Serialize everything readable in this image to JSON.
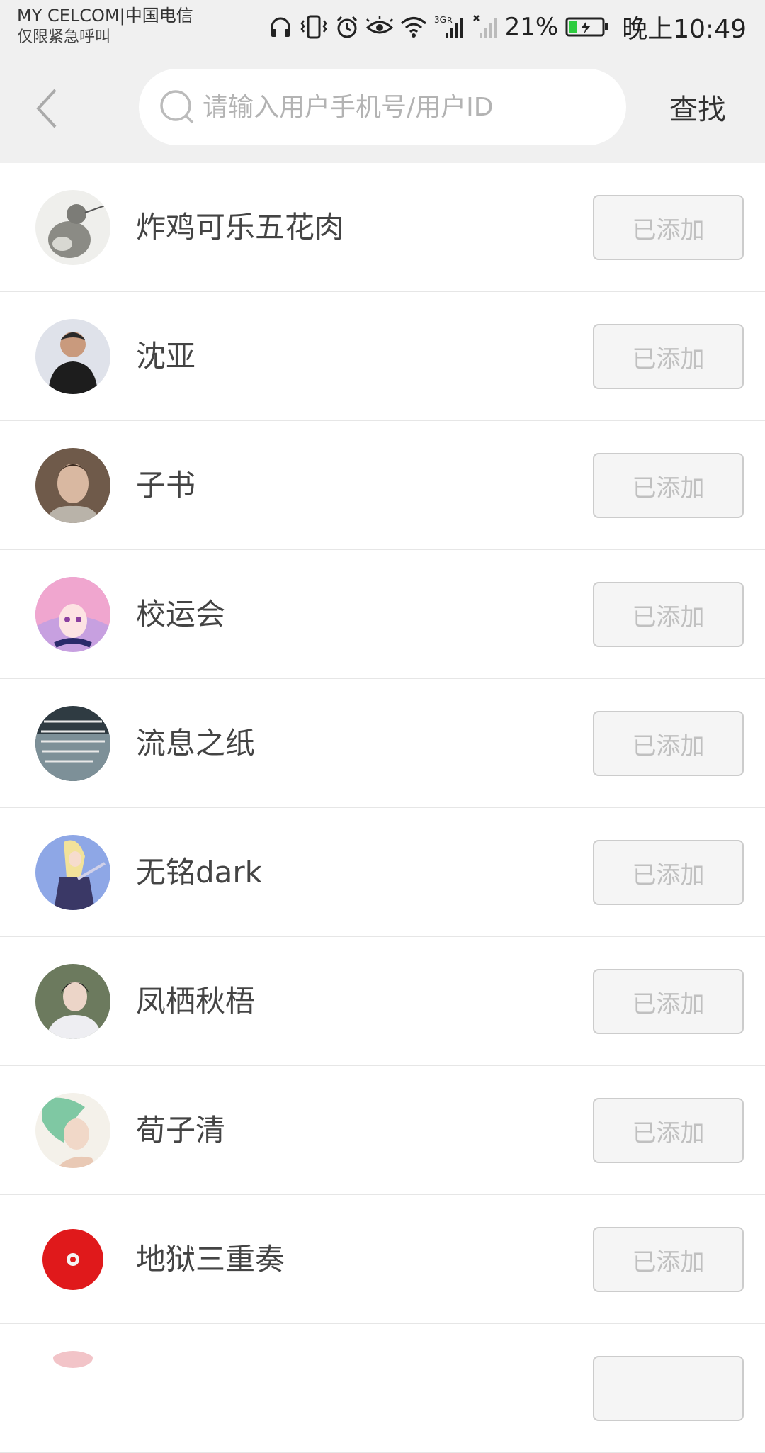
{
  "status_bar": {
    "carrier_line1": "MY CELCOM|中国电信",
    "carrier_line2": "仅限紧急呼叫",
    "battery_percent": "21%",
    "time": "晚上10:49",
    "icons": [
      "headphones-icon",
      "vibrate-icon",
      "alarm-icon",
      "eye-icon",
      "wifi-icon",
      "signal-3g-icon",
      "signal-no-service-icon",
      "battery-charging-icon"
    ],
    "network_label": "3G",
    "roaming_label": "R"
  },
  "header": {
    "back_icon": "chevron-left-icon",
    "search_placeholder": "请输入用户手机号/用户ID",
    "search_value": "",
    "find_label": "查找"
  },
  "users": [
    {
      "name": "炸鸡可乐五花肉",
      "button": "已添加",
      "avatar_color": "#e9e9e6"
    },
    {
      "name": "沈亚",
      "button": "已添加",
      "avatar_color": "#6b6f82"
    },
    {
      "name": "子书",
      "button": "已添加",
      "avatar_color": "#8a6b55"
    },
    {
      "name": "校运会",
      "button": "已添加",
      "avatar_color": "#e79bc3"
    },
    {
      "name": "流息之纸",
      "button": "已添加",
      "avatar_color": "#3c4b52"
    },
    {
      "name": "无铭dark",
      "button": "已添加",
      "avatar_color": "#6e7fbd"
    },
    {
      "name": "凤栖秋梧",
      "button": "已添加",
      "avatar_color": "#7d8a6e"
    },
    {
      "name": "荀子清",
      "button": "已添加",
      "avatar_color": "#8fc9a8"
    },
    {
      "name": "地狱三重奏",
      "button": "已添加",
      "avatar_color": "#e0191b"
    },
    {
      "name": "",
      "button": "",
      "avatar_color": "#f2c4c8"
    }
  ],
  "colors": {
    "header_bg": "#f0f0f0",
    "divider": "#e6e6e6",
    "button_border": "#cccccc",
    "button_text": "#c0c0c0"
  }
}
